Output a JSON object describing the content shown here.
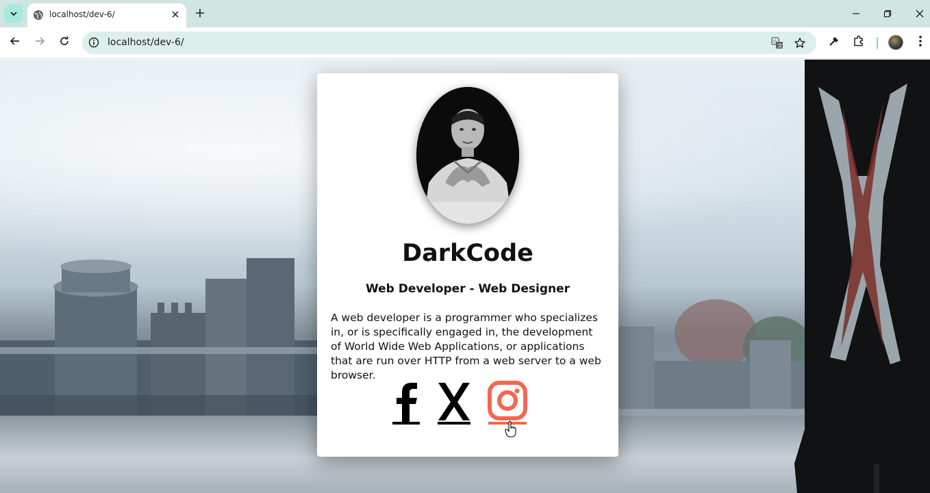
{
  "browser": {
    "tab_title": "localhost/dev-6/",
    "url": "localhost/dev-6/"
  },
  "profile": {
    "name": "DarkCode",
    "role": "Web Developer - Web Designer",
    "bio": "A web developer is a programmer who specializes in, or is specifically engaged in, the development of World Wide Web Applications, or applications that are run over HTTP from a web server to a web browser."
  },
  "social_links": [
    {
      "icon": "facebook-icon",
      "color": "#000000"
    },
    {
      "icon": "x-icon",
      "color": "#000000"
    },
    {
      "icon": "instagram-icon",
      "color": "#f4674f",
      "state": "hover"
    }
  ],
  "colors": {
    "tabstrip": "#cfe6e3",
    "omnibox": "#dcefeb",
    "card": "#ffffff",
    "hover_accent": "#f4674f"
  }
}
